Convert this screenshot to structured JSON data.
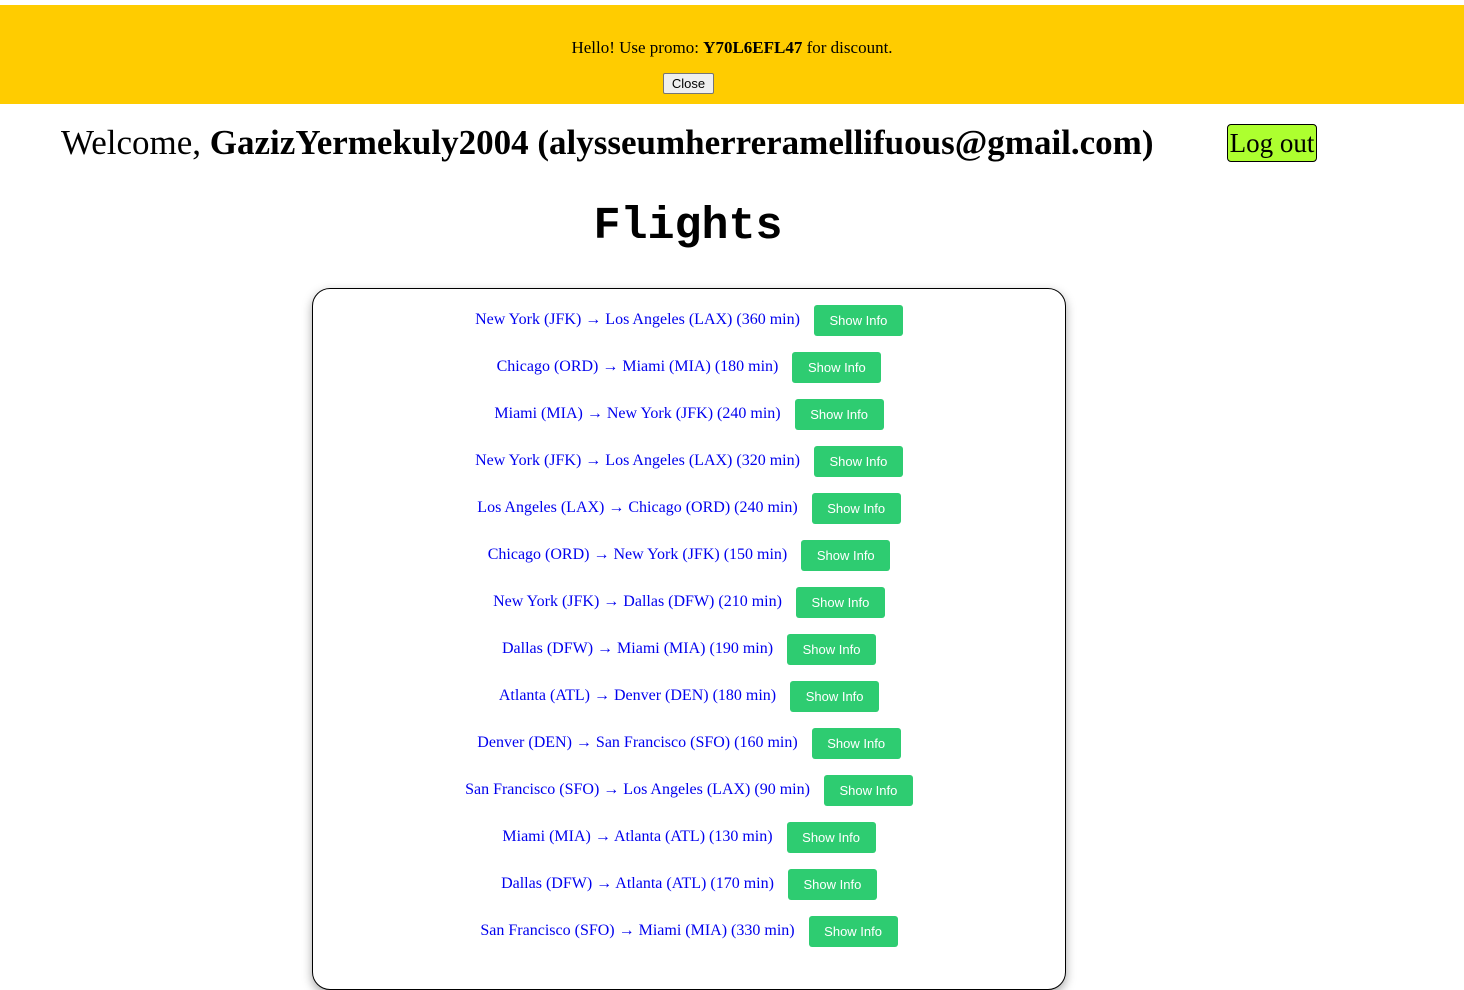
{
  "promo": {
    "prefix": "Hello! Use promo: ",
    "code": "Y70L6EFL47",
    "suffix": " for discount.",
    "close_label": "Close",
    "background_color": "#ffcc00"
  },
  "header": {
    "welcome_prefix": "Welcome, ",
    "user_display": "GazizYermekuly2004 (alysseumherreramellifuous@gmail.com)",
    "logout_label": "Log out",
    "logout_color": "#adff2f"
  },
  "page": {
    "title": "Flights"
  },
  "flights": {
    "button_label": "Show Info",
    "button_color": "#2ecc71",
    "link_color": "#0000ee",
    "items": [
      {
        "label": "New York (JFK) → Los Angeles (LAX) (360 min)"
      },
      {
        "label": "Chicago (ORD) → Miami (MIA) (180 min)"
      },
      {
        "label": "Miami (MIA) → New York (JFK) (240 min)"
      },
      {
        "label": "New York (JFK) → Los Angeles (LAX) (320 min)"
      },
      {
        "label": "Los Angeles (LAX) → Chicago (ORD) (240 min)"
      },
      {
        "label": "Chicago (ORD) → New York (JFK) (150 min)"
      },
      {
        "label": "New York (JFK) → Dallas (DFW) (210 min)"
      },
      {
        "label": "Dallas (DFW) → Miami (MIA) (190 min)"
      },
      {
        "label": "Atlanta (ATL) → Denver (DEN) (180 min)"
      },
      {
        "label": "Denver (DEN) → San Francisco (SFO) (160 min)"
      },
      {
        "label": "San Francisco (SFO) → Los Angeles (LAX) (90 min)"
      },
      {
        "label": "Miami (MIA) → Atlanta (ATL) (130 min)"
      },
      {
        "label": "Dallas (DFW) → Atlanta (ATL) (170 min)"
      },
      {
        "label": "San Francisco (SFO) → Miami (MIA) (330 min)"
      }
    ]
  }
}
